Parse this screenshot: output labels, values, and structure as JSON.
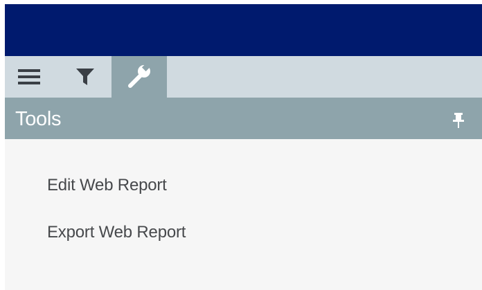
{
  "header": {
    "color": "#001a6e"
  },
  "toolbar": {
    "buttons": [
      {
        "icon": "hamburger-menu-icon",
        "active": false
      },
      {
        "icon": "filter-icon",
        "active": false
      },
      {
        "icon": "wrench-icon",
        "active": true
      }
    ],
    "background": "#d0dae0",
    "active_background": "#8ea4ab"
  },
  "panel": {
    "title": "Tools",
    "pin_icon": "pin-icon",
    "items": [
      {
        "label": "Edit Web Report"
      },
      {
        "label": "Export Web Report"
      }
    ]
  },
  "colors": {
    "panel_header": "#8ea4ab",
    "body_background": "#f6f6f6",
    "item_text": "#47494c",
    "icon_dark": "#3a3f45"
  }
}
